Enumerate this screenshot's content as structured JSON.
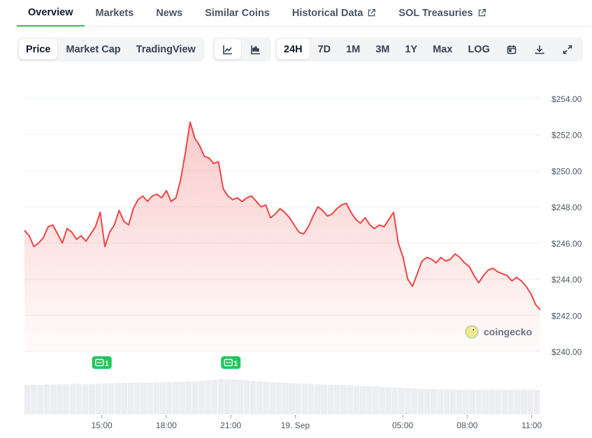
{
  "tabs": [
    {
      "label": "Overview",
      "active": true,
      "external": false
    },
    {
      "label": "Markets",
      "active": false,
      "external": false
    },
    {
      "label": "News",
      "active": false,
      "external": false
    },
    {
      "label": "Similar Coins",
      "active": false,
      "external": false
    },
    {
      "label": "Historical Data",
      "active": false,
      "external": true
    },
    {
      "label": "SOL Treasuries",
      "active": false,
      "external": true
    }
  ],
  "chart_type_tabs": [
    {
      "label": "Price",
      "active": true
    },
    {
      "label": "Market Cap",
      "active": false
    },
    {
      "label": "TradingView",
      "active": false
    }
  ],
  "view_icons": [
    {
      "icon": "line-chart-icon",
      "active": true
    },
    {
      "icon": "candlestick-chart-icon",
      "active": false
    }
  ],
  "ranges": [
    {
      "label": "24H",
      "active": true
    },
    {
      "label": "7D",
      "active": false
    },
    {
      "label": "1M",
      "active": false
    },
    {
      "label": "3M",
      "active": false
    },
    {
      "label": "1Y",
      "active": false
    },
    {
      "label": "Max",
      "active": false
    },
    {
      "label": "LOG",
      "active": false
    }
  ],
  "tool_icons": [
    "calendar-icon",
    "download-icon",
    "fullscreen-icon"
  ],
  "watermark": "coingecko",
  "colors": {
    "line": "#ef4444",
    "accent": "#22c55e",
    "news": "#22c55e"
  },
  "chart_data": {
    "type": "area",
    "y_ticks": [
      "$254.00",
      "$252.00",
      "$250.00",
      "$248.00",
      "$246.00",
      "$244.00",
      "$242.00",
      "$240.00"
    ],
    "ylim": [
      240,
      254
    ],
    "x_ticks": [
      {
        "t": 3,
        "label": "15:00"
      },
      {
        "t": 6,
        "label": "18:00"
      },
      {
        "t": 9,
        "label": "21:00"
      },
      {
        "t": 12,
        "label": "19. Sep"
      },
      {
        "t": 17,
        "label": "05:00"
      },
      {
        "t": 20,
        "label": "08:00"
      },
      {
        "t": 23,
        "label": "11:00"
      }
    ],
    "xlim": [
      -0.6,
      23.4
    ],
    "news_markers": [
      {
        "t": 3.0,
        "count": "1"
      },
      {
        "t": 9.0,
        "count": "1"
      }
    ],
    "prices": [
      246.7,
      246.4,
      245.8,
      246.0,
      246.3,
      246.9,
      247.0,
      246.5,
      246.0,
      246.8,
      246.6,
      246.2,
      246.4,
      246.1,
      246.5,
      246.9,
      247.7,
      245.8,
      246.6,
      247.0,
      247.8,
      247.2,
      247.0,
      247.9,
      248.4,
      248.6,
      248.3,
      248.6,
      248.7,
      248.5,
      248.9,
      248.3,
      248.5,
      249.5,
      251.0,
      252.7,
      251.8,
      251.4,
      250.8,
      250.7,
      250.4,
      250.5,
      249.0,
      248.6,
      248.4,
      248.5,
      248.3,
      248.5,
      248.6,
      248.3,
      248.0,
      248.1,
      247.4,
      247.6,
      247.9,
      247.7,
      247.4,
      247.0,
      246.6,
      246.5,
      246.9,
      247.5,
      248.0,
      247.8,
      247.5,
      247.6,
      247.9,
      248.1,
      248.2,
      247.7,
      247.3,
      247.1,
      247.4,
      247.0,
      246.8,
      247.0,
      246.9,
      247.3,
      247.7,
      246.0,
      245.2,
      244.0,
      243.6,
      244.3,
      245.0,
      245.2,
      245.1,
      244.9,
      245.2,
      245.0,
      245.1,
      245.4,
      245.2,
      244.9,
      244.7,
      244.2,
      243.8,
      244.2,
      244.5,
      244.6,
      244.4,
      244.3,
      244.2,
      243.9,
      244.1,
      243.9,
      243.6,
      243.2,
      242.6,
      242.3
    ],
    "volume": [
      0.93,
      0.94,
      0.94,
      0.95,
      0.95,
      0.96,
      0.96,
      0.97,
      0.97,
      0.96,
      0.96,
      0.97,
      0.98,
      0.98,
      0.99,
      1.0,
      1.0,
      1.01,
      1.01,
      1.0,
      1.01,
      1.02,
      1.02,
      1.03,
      1.03,
      1.04,
      1.05,
      1.06,
      1.08,
      1.1,
      1.12,
      1.12,
      1.11,
      1.09,
      1.07,
      1.05,
      1.04,
      1.03,
      1.02,
      1.01,
      1.0,
      0.99,
      0.98,
      0.97,
      0.97,
      0.96,
      0.95,
      0.94,
      0.94,
      0.93,
      0.92,
      0.91,
      0.9,
      0.89,
      0.88,
      0.87,
      0.86,
      0.85,
      0.84,
      0.83,
      0.82,
      0.81,
      0.8,
      0.8,
      0.79,
      0.79,
      0.79,
      0.78,
      0.78,
      0.78,
      0.78,
      0.78,
      0.78,
      0.78,
      0.78,
      0.78,
      0.78,
      0.78,
      0.78,
      0.78
    ]
  }
}
